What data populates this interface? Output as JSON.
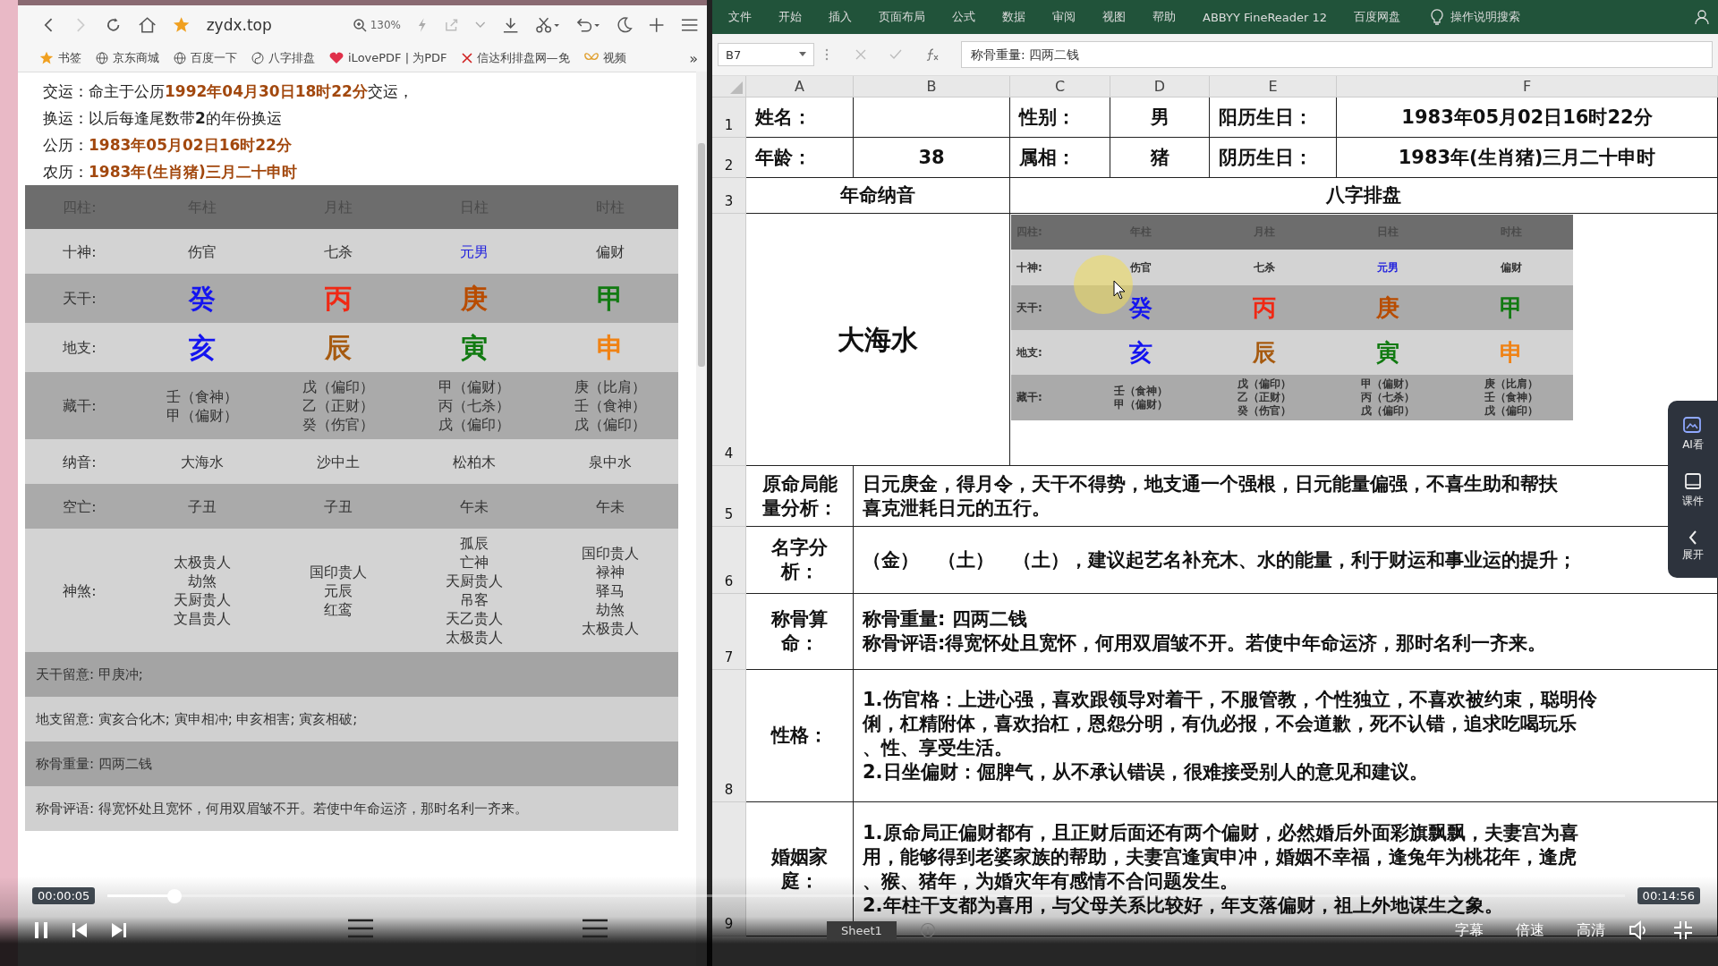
{
  "browser": {
    "url": "zydx.top",
    "zoom": "130%",
    "bookmarks": [
      {
        "label": "书签",
        "kind": "star"
      },
      {
        "label": "京东商城",
        "kind": "globe"
      },
      {
        "label": "百度一下",
        "kind": "globe"
      },
      {
        "label": "八字排盘",
        "kind": "swirl"
      },
      {
        "label": "iLovePDF | 为PDF",
        "kind": "heart"
      },
      {
        "label": "信达利排盘网—免",
        "kind": "cross"
      },
      {
        "label": "视频",
        "kind": "butterfly"
      }
    ],
    "more": "»"
  },
  "info_lines": [
    {
      "label": "交运：",
      "parts": [
        {
          "text": "命主于公历",
          "highlight": false
        },
        {
          "text": "1992年04月30日18时22分",
          "highlight": true
        },
        {
          "text": "交运，",
          "highlight": false
        }
      ]
    },
    {
      "label": "换运：",
      "parts": [
        {
          "text": "以后每逢尾数带**2**的年份换运",
          "highlight": false
        }
      ]
    },
    {
      "label": "公历：",
      "parts": [
        {
          "text": "1983年05月02日16时22分",
          "highlight": true
        }
      ]
    },
    {
      "label": "农历：",
      "parts": [
        {
          "text": "1983年(生肖猪)三月二十申时",
          "highlight": true
        }
      ]
    }
  ],
  "bazi": {
    "header": [
      "四柱:",
      "年柱",
      "月柱",
      "日柱",
      "时柱"
    ],
    "rows": [
      {
        "label": "十神:",
        "kind": "text",
        "cells": [
          {
            "lines": [
              "伤官"
            ]
          },
          {
            "lines": [
              "七杀"
            ]
          },
          {
            "lines": [
              "元男"
            ],
            "color": "#2222dd"
          },
          {
            "lines": [
              "偏财"
            ]
          }
        ]
      },
      {
        "label": "天干:",
        "kind": "glyph",
        "cells": [
          {
            "lines": [
              "癸"
            ],
            "color": "#1414f0"
          },
          {
            "lines": [
              "丙"
            ],
            "color": "#f02814"
          },
          {
            "lines": [
              "庚"
            ],
            "color": "#b84c00"
          },
          {
            "lines": [
              "甲"
            ],
            "color": "#117a11"
          }
        ]
      },
      {
        "label": "地支:",
        "kind": "glyph",
        "cells": [
          {
            "lines": [
              "亥"
            ],
            "color": "#1414f0"
          },
          {
            "lines": [
              "辰"
            ],
            "color": "#a65a0f"
          },
          {
            "lines": [
              "寅"
            ],
            "color": "#117a11"
          },
          {
            "lines": [
              "申"
            ],
            "color": "#f08214"
          }
        ]
      },
      {
        "label": "藏干:",
        "kind": "text",
        "cells": [
          {
            "lines": [
              "壬（食神）",
              "甲（偏财）"
            ]
          },
          {
            "lines": [
              "戊（偏印）",
              "乙（正财）",
              "癸（伤官）"
            ]
          },
          {
            "lines": [
              "甲（偏财）",
              "丙（七杀）",
              "戊（偏印）"
            ]
          },
          {
            "lines": [
              "庚（比肩）",
              "壬（食神）",
              "戊（偏印）"
            ]
          }
        ]
      },
      {
        "label": "纳音:",
        "kind": "text",
        "cells": [
          {
            "lines": [
              "大海水"
            ]
          },
          {
            "lines": [
              "沙中土"
            ]
          },
          {
            "lines": [
              "松柏木"
            ]
          },
          {
            "lines": [
              "泉中水"
            ]
          }
        ]
      },
      {
        "label": "空亡:",
        "kind": "text",
        "cells": [
          {
            "lines": [
              "子丑"
            ]
          },
          {
            "lines": [
              "子丑"
            ]
          },
          {
            "lines": [
              "午未"
            ]
          },
          {
            "lines": [
              "午未"
            ]
          }
        ]
      },
      {
        "label": "神煞:",
        "kind": "text",
        "cells": [
          {
            "lines": [
              "太极贵人",
              "劫煞",
              "天厨贵人",
              "文昌贵人"
            ]
          },
          {
            "lines": [
              "国印贵人",
              "元辰",
              "红鸾"
            ]
          },
          {
            "lines": [
              "孤辰",
              "亡神",
              "天厨贵人",
              "吊客",
              "天乙贵人",
              "太极贵人"
            ]
          },
          {
            "lines": [
              "国印贵人",
              "禄神",
              "驿马",
              "劫煞",
              "太极贵人"
            ]
          }
        ]
      }
    ],
    "notes": [
      "天干留意: 甲庚冲;",
      "地支留意: 寅亥合化木; 寅申相冲; 申亥相害; 寅亥相破;",
      "称骨重量: 四两二钱",
      "称骨评语: 得宽怀处且宽怀，何用双眉皱不开。若使中年命运济，那时名利一齐来。"
    ]
  },
  "excel": {
    "menu": [
      "文件",
      "开始",
      "插入",
      "页面布局",
      "公式",
      "数据",
      "审阅",
      "视图",
      "帮助",
      "ABBYY FineReader 12",
      "百度网盘"
    ],
    "search": "操作说明搜索",
    "name_box": "B7",
    "formula": "称骨重量: 四两二钱",
    "columns": [
      "A",
      "B",
      "C",
      "D",
      "E",
      "F"
    ],
    "rows": [
      {
        "number": "1",
        "kind": "fields",
        "cells": [
          {
            "lines": [
              "姓名："
            ]
          },
          {},
          {
            "lines": [
              "性别："
            ]
          },
          {
            "lines": [
              "男"
            ]
          },
          {
            "lines": [
              "阳历生日："
            ]
          },
          {
            "lines": [
              "1983年05月02日16时22分"
            ]
          }
        ]
      },
      {
        "number": "2",
        "kind": "fields",
        "cells": [
          {
            "lines": [
              "年龄："
            ]
          },
          {
            "lines": [
              "38"
            ]
          },
          {
            "lines": [
              "属相："
            ]
          },
          {
            "lines": [
              "猪"
            ]
          },
          {
            "lines": [
              "阴历生日："
            ]
          },
          {
            "lines": [
              "1983年(生肖猪)三月二十申时"
            ]
          }
        ]
      },
      {
        "number": "3",
        "kind": "banner",
        "cells": [
          {
            "lines": [
              "年命纳音"
            ]
          },
          {
            "lines": [
              "八字排盘"
            ]
          }
        ]
      },
      {
        "number": "4",
        "kind": "banner",
        "cells": [
          {
            "lines": [
              "大海水"
            ],
            "kind": "title"
          },
          {
            "kind": "embedded"
          }
        ]
      },
      {
        "number": "5",
        "kind": "section",
        "cells": [
          {
            "lines": [
              "原命局能",
              "量分析："
            ]
          },
          {
            "lines": [
              "日元庚金，得月令，天干不得势，地支通一个强根，日元能量偏强，不喜生助和帮扶",
              "喜克泄耗日元的五行。"
            ]
          }
        ]
      },
      {
        "number": "6",
        "kind": "section",
        "cells": [
          {
            "lines": [
              "名字分",
              "析："
            ]
          },
          {
            "lines": [
              "（金）　（土）　（土），建议起艺名补充木、水的能量，利于财运和事业运的提升；"
            ]
          }
        ]
      },
      {
        "number": "7",
        "kind": "section",
        "cells": [
          {
            "lines": [
              "称骨算",
              "命："
            ]
          },
          {
            "lines": [
              "称骨重量: 四两二钱",
              "称骨评语:得宽怀处且宽怀，何用双眉皱不开。若使中年命运济，那时名利一齐来。"
            ]
          }
        ]
      },
      {
        "number": "8",
        "kind": "section",
        "cells": [
          {
            "lines": [
              "性格："
            ]
          },
          {
            "lines": [
              "1.伤官格：上进心强，喜欢跟领导对着干，不服管教，个性独立，不喜欢被约束，聪明伶",
              "俐，杠精附体，喜欢抬杠，恩怨分明，有仇必报，不会道歉，死不认错，追求吃喝玩乐",
              "、性、享受生活。",
              "2.日坐偏财：倔脾气，从不承认错误，很难接受别人的意见和建议。"
            ]
          }
        ]
      },
      {
        "number": "9",
        "kind": "section",
        "cells": [
          {
            "lines": [
              "婚姻家",
              "庭："
            ]
          },
          {
            "lines": [
              "1.原命局正偏财都有，且正财后面还有两个偏财，必然婚后外面彩旗飘飘，夫妻宫为喜",
              "用，能够得到老婆家族的帮助，夫妻宫逢寅申冲，婚姻不幸福，逢兔年为桃花年，逢虎",
              "、猴、猪年，为婚灾年有感情不合问题发生。",
              "2.年柱干支都为喜用，与父母关系比较好，年支落偏财，祖上外地谋生之象。"
            ]
          }
        ]
      }
    ],
    "embedded_table": {
      "header": [
        "四柱:",
        "年柱",
        "月柱",
        "日柱",
        "时柱"
      ],
      "rows": [
        {
          "label": "十神:",
          "kind": "text",
          "cells": [
            {
              "lines": [
                "伤官"
              ]
            },
            {
              "lines": [
                "七杀"
              ]
            },
            {
              "lines": [
                "元男"
              ],
              "color": "#2222dd"
            },
            {
              "lines": [
                "偏财"
              ]
            }
          ]
        },
        {
          "label": "天干:",
          "kind": "glyph",
          "cells": [
            {
              "lines": [
                "癸"
              ],
              "color": "#1414f0"
            },
            {
              "lines": [
                "丙"
              ],
              "color": "#f02814"
            },
            {
              "lines": [
                "庚"
              ],
              "color": "#b84c00"
            },
            {
              "lines": [
                "甲"
              ],
              "color": "#117a11"
            }
          ]
        },
        {
          "label": "地支:",
          "kind": "glyph",
          "cells": [
            {
              "lines": [
                "亥"
              ],
              "color": "#1414f0"
            },
            {
              "lines": [
                "辰"
              ],
              "color": "#a65a0f"
            },
            {
              "lines": [
                "寅"
              ],
              "color": "#117a11"
            },
            {
              "lines": [
                "申"
              ],
              "color": "#f08214"
            }
          ]
        },
        {
          "label": "藏干:",
          "kind": "text",
          "cells": [
            {
              "lines": [
                "壬（食神）",
                "甲（偏财）"
              ]
            },
            {
              "lines": [
                "戊（偏印）",
                "乙（正财）",
                "癸（伤官）"
              ]
            },
            {
              "lines": [
                "甲（偏财）",
                "丙（七杀）",
                "戊（偏印）"
              ]
            },
            {
              "lines": [
                "庚（比肩）",
                "壬（食神）",
                "戊（偏印）"
              ]
            }
          ]
        }
      ]
    },
    "sheet_tab": "Sheet1"
  },
  "side_panel": [
    {
      "label": "AI看",
      "kind": "ai"
    },
    {
      "label": "课件",
      "kind": "book"
    },
    {
      "label": "展开",
      "kind": "chevron"
    }
  ],
  "player": {
    "elapsed": "00:00:05",
    "total": "00:14:56",
    "level": 0.044,
    "options": [
      "字幕",
      "倍速",
      "高清"
    ]
  }
}
